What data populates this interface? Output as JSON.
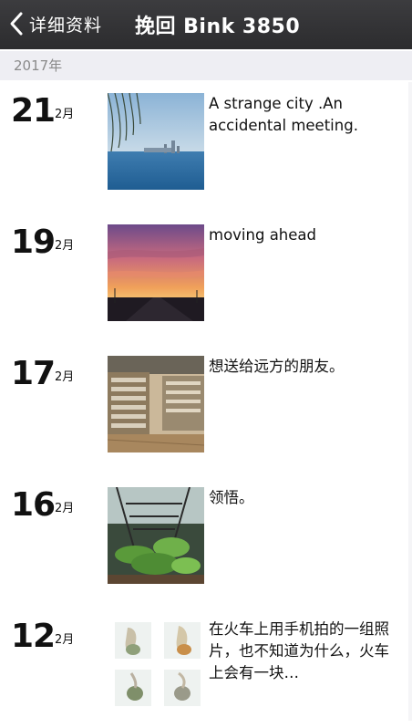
{
  "nav": {
    "back_label": "详细资料",
    "title": "挽回 Bink 3850"
  },
  "year": "2017年",
  "posts": [
    {
      "day": "21",
      "month": "2月",
      "text": "A strange city .An accidental meeting.",
      "image": "lake-skyline-photo"
    },
    {
      "day": "19",
      "month": "2月",
      "text": "moving ahead",
      "image": "sunset-road-photo"
    },
    {
      "day": "17",
      "month": "2月",
      "text": "想送给远方的朋友。",
      "image": "bookstore-photo"
    },
    {
      "day": "16",
      "month": "2月",
      "text": "领悟。",
      "image": "plant-stairs-photo"
    },
    {
      "day": "12",
      "month": "2月",
      "text": "在火车上用手机拍的一组照片，也不知道为什么，火车上会有一块…",
      "image": "train-photos-grid"
    }
  ],
  "colors": {
    "nav_bg": "#2e2e30",
    "year_bar_bg": "#eeeef3",
    "year_text": "#8a8a8a"
  }
}
